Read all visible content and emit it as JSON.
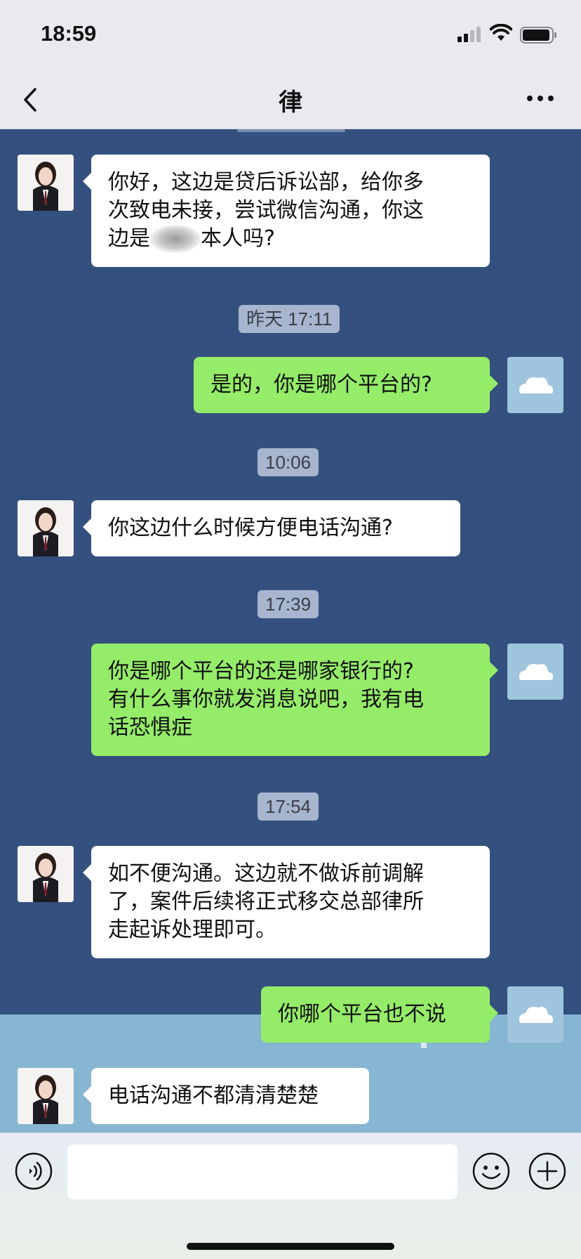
{
  "status_bar": {
    "time": "18:59"
  },
  "nav": {
    "title": "律",
    "back_icon": "chevron-left-icon",
    "more_icon": "ellipsis-icon"
  },
  "messages": [
    {
      "side": "left",
      "lines": [
        "你好，这边是贷后诉讼部，给你多",
        "次致电未接，尝试微信沟通，你这"
      ],
      "line3_before": "边是",
      "line3_after": "本人吗?"
    },
    {
      "side": "right",
      "text": "是的，你是哪个平台的?"
    },
    {
      "side": "left",
      "text": "你这边什么时候方便电话沟通?"
    },
    {
      "side": "right",
      "lines": [
        "你是哪个平台的还是哪家银行的?",
        "有什么事你就发消息说吧，我有电",
        "话恐惧症"
      ]
    },
    {
      "side": "left",
      "lines": [
        "如不便沟通。这边就不做诉前调解",
        "了，案件后续将正式移交总部律所",
        "走起诉处理即可。"
      ]
    },
    {
      "side": "right",
      "text": "你哪个平台也不说"
    },
    {
      "side": "left",
      "text": "电话沟通不都清清楚楚"
    }
  ],
  "timestamps": [
    "昨天 17:11",
    "10:06",
    "17:39",
    "17:54"
  ],
  "input": {
    "placeholder": "",
    "voice_icon": "voice-icon",
    "emoji_icon": "emoji-icon",
    "add_icon": "plus-icon"
  },
  "colors": {
    "chat_background": "#34507f",
    "outgoing_bubble": "#95ec69",
    "incoming_bubble": "#ffffff"
  }
}
